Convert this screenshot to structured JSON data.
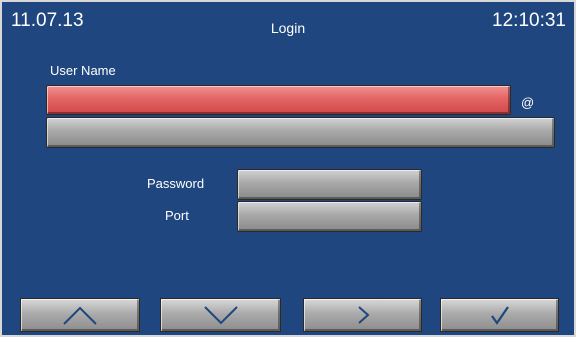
{
  "header": {
    "date": "11.07.13",
    "title": "Login",
    "time": "12:10:31"
  },
  "form": {
    "username_label": "User Name",
    "username_value": "",
    "at_symbol": "@",
    "domain_value": "",
    "password_label": "Password",
    "password_value": "",
    "port_label": "Port",
    "port_value": ""
  },
  "nav": {
    "buttons": [
      {
        "name": "up",
        "icon": "chevron-up-icon"
      },
      {
        "name": "down",
        "icon": "chevron-down-icon"
      },
      {
        "name": "next",
        "icon": "chevron-right-icon"
      },
      {
        "name": "confirm",
        "icon": "checkmark-icon"
      }
    ]
  },
  "colors": {
    "background": "#1f467e",
    "active_field": "#e46464",
    "inactive_field": "#a8a8a8",
    "icon_stroke": "#1f467e"
  }
}
